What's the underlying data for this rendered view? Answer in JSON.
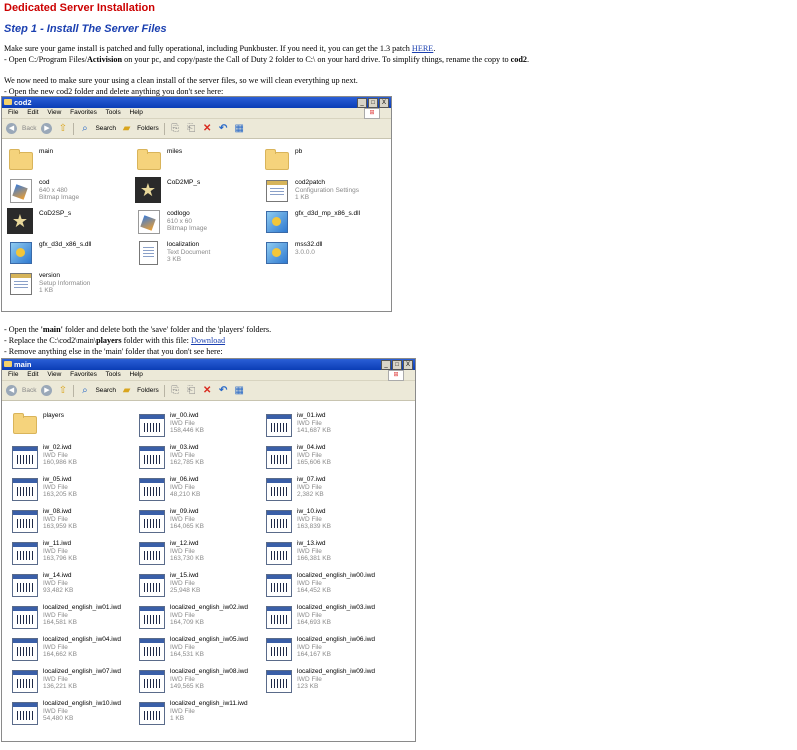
{
  "heading": "Dedicated Server Installation",
  "step": "Step 1 - Install The Server Files",
  "para1": {
    "line1_pre": "Make sure your game install is patched and fully operational, including Punkbuster. If you need it, you can get the 1.3 patch",
    "line1_link": "HERE",
    "line1_post": ".",
    "line2_a": "- Open C:/Program Files/",
    "line2_b": "Activision",
    "line2_c": " on your pc, and copy/paste the Call of Duty 2 folder to C:\\ on your hard drive. To simplify things, rename the copy to ",
    "line2_d": "cod2",
    "line2_e": "."
  },
  "para2": {
    "line1": "We now need to make sure your using a clean install of the server files, so we will clean everything up next.",
    "line2": "- Open the new cod2 folder and delete anything you don't see here:"
  },
  "para3": {
    "line1_a": "- Open the ",
    "line1_b": "'main'",
    "line1_c": " folder and delete both the 'save' folder and the 'players' folders.",
    "line2_a": "- Replace the C:\\cod2\\main\\",
    "line2_b": "players",
    "line2_c": " folder with this file: ",
    "line2_link": "Download",
    "line3": "- Remove anything else in the 'main' folder that you don't see here:"
  },
  "explorer": {
    "menus": [
      "File",
      "Edit",
      "View",
      "Favorites",
      "Tools",
      "Help"
    ],
    "back": "Back",
    "search": "Search",
    "folders": "Folders",
    "min": "_",
    "max": "□",
    "close": "X"
  },
  "win1": {
    "title": "cod2",
    "items": [
      {
        "name": "main",
        "icon": "folder-icon",
        "l1": "",
        "l2": ""
      },
      {
        "name": "miles",
        "icon": "folder-icon",
        "l1": "",
        "l2": ""
      },
      {
        "name": "pb",
        "icon": "folder-icon",
        "l1": "",
        "l2": ""
      },
      {
        "name": "cod",
        "icon": "bitmap-icon",
        "l1": "640 x 480",
        "l2": "Bitmap Image"
      },
      {
        "name": "CoD2MP_s",
        "icon": "cod2-exe-icon",
        "l1": "",
        "l2": ""
      },
      {
        "name": "cod2patch",
        "icon": "settings-file-icon",
        "l1": "Configuration Settings",
        "l2": "1 KB"
      },
      {
        "name": "CoD2SP_s",
        "icon": "cod2-exe-icon",
        "l1": "",
        "l2": ""
      },
      {
        "name": "codlogo",
        "icon": "bitmap-icon",
        "l1": "610 x 60",
        "l2": "Bitmap Image"
      },
      {
        "name": "gfx_d3d_mp_x86_s.dll",
        "icon": "dll-icon",
        "l1": "",
        "l2": ""
      },
      {
        "name": "gfx_d3d_x86_s.dll",
        "icon": "dll-icon",
        "l1": "",
        "l2": ""
      },
      {
        "name": "localization",
        "icon": "text-document-icon",
        "l1": "Text Document",
        "l2": "3 KB"
      },
      {
        "name": "mss32.dll",
        "icon": "dll-icon",
        "l1": "3.0.0.0",
        "l2": ""
      },
      {
        "name": "version",
        "icon": "setup-info-icon",
        "l1": "Setup Information",
        "l2": "1 KB"
      }
    ]
  },
  "win2": {
    "title": "main",
    "items": [
      {
        "name": "players",
        "icon": "folder-icon",
        "l1": "",
        "l2": ""
      },
      {
        "name": "iw_00.iwd",
        "icon": "iwd-file-icon",
        "l1": "IWD File",
        "l2": "158,446 KB"
      },
      {
        "name": "iw_01.iwd",
        "icon": "iwd-file-icon",
        "l1": "IWD File",
        "l2": "141,687 KB"
      },
      {
        "name": "iw_02.iwd",
        "icon": "iwd-file-icon",
        "l1": "IWD File",
        "l2": "160,986 KB"
      },
      {
        "name": "iw_03.iwd",
        "icon": "iwd-file-icon",
        "l1": "IWD File",
        "l2": "162,785 KB"
      },
      {
        "name": "iw_04.iwd",
        "icon": "iwd-file-icon",
        "l1": "IWD File",
        "l2": "165,606 KB"
      },
      {
        "name": "iw_05.iwd",
        "icon": "iwd-file-icon",
        "l1": "IWD File",
        "l2": "163,205 KB"
      },
      {
        "name": "iw_06.iwd",
        "icon": "iwd-file-icon",
        "l1": "IWD File",
        "l2": "48,210 KB"
      },
      {
        "name": "iw_07.iwd",
        "icon": "iwd-file-icon",
        "l1": "IWD File",
        "l2": "2,382 KB"
      },
      {
        "name": "iw_08.iwd",
        "icon": "iwd-file-icon",
        "l1": "IWD File",
        "l2": "163,959 KB"
      },
      {
        "name": "iw_09.iwd",
        "icon": "iwd-file-icon",
        "l1": "IWD File",
        "l2": "164,065 KB"
      },
      {
        "name": "iw_10.iwd",
        "icon": "iwd-file-icon",
        "l1": "IWD File",
        "l2": "163,839 KB"
      },
      {
        "name": "iw_11.iwd",
        "icon": "iwd-file-icon",
        "l1": "IWD File",
        "l2": "163,796 KB"
      },
      {
        "name": "iw_12.iwd",
        "icon": "iwd-file-icon",
        "l1": "IWD File",
        "l2": "163,730 KB"
      },
      {
        "name": "iw_13.iwd",
        "icon": "iwd-file-icon",
        "l1": "IWD File",
        "l2": "166,381 KB"
      },
      {
        "name": "iw_14.iwd",
        "icon": "iwd-file-icon",
        "l1": "IWD File",
        "l2": "93,482 KB"
      },
      {
        "name": "iw_15.iwd",
        "icon": "iwd-file-icon",
        "l1": "IWD File",
        "l2": "25,948 KB"
      },
      {
        "name": "localized_english_iw00.iwd",
        "icon": "iwd-file-icon",
        "l1": "IWD File",
        "l2": "164,452 KB"
      },
      {
        "name": "localized_english_iw01.iwd",
        "icon": "iwd-file-icon",
        "l1": "IWD File",
        "l2": "164,581 KB"
      },
      {
        "name": "localized_english_iw02.iwd",
        "icon": "iwd-file-icon",
        "l1": "IWD File",
        "l2": "164,709 KB"
      },
      {
        "name": "localized_english_iw03.iwd",
        "icon": "iwd-file-icon",
        "l1": "IWD File",
        "l2": "164,693 KB"
      },
      {
        "name": "localized_english_iw04.iwd",
        "icon": "iwd-file-icon",
        "l1": "IWD File",
        "l2": "164,662 KB"
      },
      {
        "name": "localized_english_iw05.iwd",
        "icon": "iwd-file-icon",
        "l1": "IWD File",
        "l2": "164,531 KB"
      },
      {
        "name": "localized_english_iw06.iwd",
        "icon": "iwd-file-icon",
        "l1": "IWD File",
        "l2": "164,167 KB"
      },
      {
        "name": "localized_english_iw07.iwd",
        "icon": "iwd-file-icon",
        "l1": "IWD File",
        "l2": "136,221 KB"
      },
      {
        "name": "localized_english_iw08.iwd",
        "icon": "iwd-file-icon",
        "l1": "IWD File",
        "l2": "149,565 KB"
      },
      {
        "name": "localized_english_iw09.iwd",
        "icon": "iwd-file-icon",
        "l1": "IWD File",
        "l2": "123 KB"
      },
      {
        "name": "localized_english_iw10.iwd",
        "icon": "iwd-file-icon",
        "l1": "IWD File",
        "l2": "54,480 KB"
      },
      {
        "name": "localized_english_iw11.iwd",
        "icon": "iwd-file-icon",
        "l1": "IWD File",
        "l2": "1 KB"
      }
    ]
  }
}
